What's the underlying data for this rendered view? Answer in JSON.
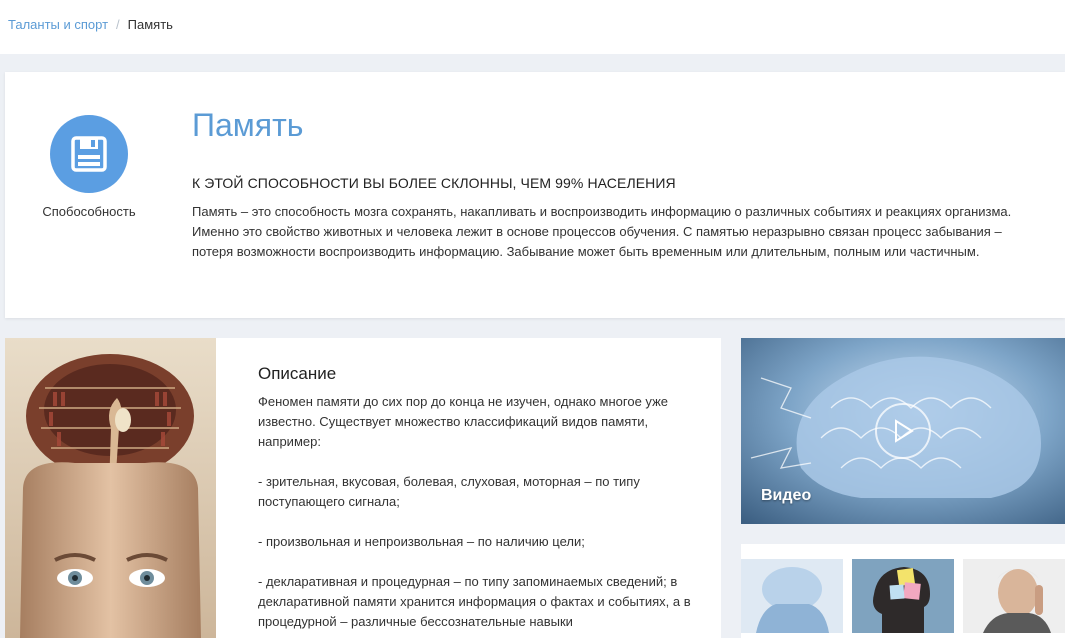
{
  "breadcrumb": {
    "parent": "Таланты и спорт",
    "separator": "/",
    "current": "Память"
  },
  "hero": {
    "ability_icon": "floppy-disk-icon",
    "ability_label": "Спобособность",
    "title": "Память",
    "subtitle": "К ЭТОЙ СПОСОБНОСТИ ВЫ БОЛЕЕ СКЛОННЫ, ЧЕМ 99% НАСЕЛЕНИЯ",
    "text": "Память – это способность мозга сохранять, накапливать и воспроизводить информацию о различных событиях и реакциях организма. Именно это свойство животных и человека лежит в основе процессов обучения. С памятью неразрывно связан процесс забывания – потеря возможности воспроизводить информацию. Забывание может быть временным или длительным, полным или частичным."
  },
  "description": {
    "title": "Описание",
    "paragraphs": [
      "Феномен памяти до сих пор до конца не изучен, однако многое уже известно. Существует множество классификаций видов памяти, например:",
      "- зрительная, вкусовая, болевая, слуховая, моторная – по типу поступающего сигнала;",
      "- произвольная и непроизвольная – по наличию цели;",
      "- декларативная и процедурная – по типу запоминаемых сведений; в декларативной памяти хранится информация о фактах и событиях, а в процедурной – различные бессознательные навыки"
    ]
  },
  "video": {
    "label": "Видео",
    "icon": "play-icon"
  },
  "colors": {
    "accent": "#5b9bd5",
    "circle": "#5b9ee2",
    "background": "#edf0f5"
  }
}
